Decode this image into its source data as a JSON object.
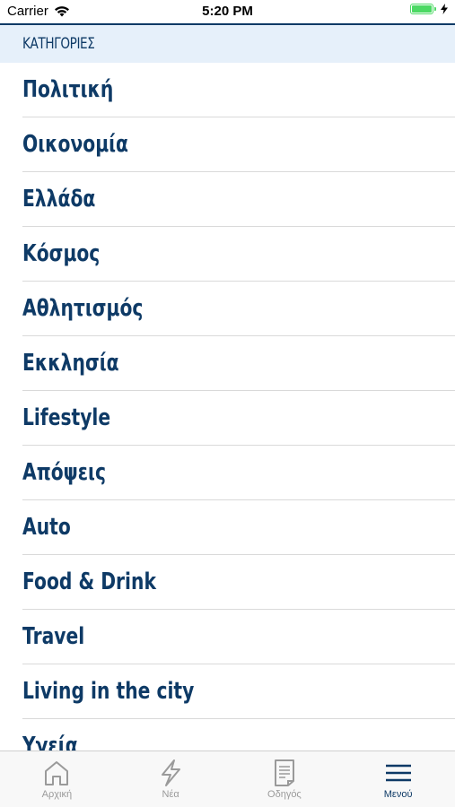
{
  "status_bar": {
    "carrier": "Carrier",
    "time": "5:20 PM",
    "battery_level": 1.0
  },
  "section": {
    "title": "ΚΑΤΗΓΟΡΙΕΣ"
  },
  "categories": [
    "Πολιτική",
    "Οικονομία",
    "Ελλάδα",
    "Κόσμος",
    "Αθλητισμός",
    "Εκκλησία",
    "Lifestyle",
    "Απόψεις",
    "Auto",
    "Food & Drink",
    "Travel",
    "Living in the city",
    "Υγεία"
  ],
  "tabs": [
    {
      "label": "Αρχική",
      "icon": "home-icon",
      "active": false
    },
    {
      "label": "Νέα",
      "icon": "lightning-icon",
      "active": false
    },
    {
      "label": "Οδηγός",
      "icon": "document-icon",
      "active": false
    },
    {
      "label": "Μενού",
      "icon": "menu-icon",
      "active": true
    }
  ],
  "colors": {
    "brand": "#0e3a66",
    "header_bg": "#e6f0fa",
    "inactive": "#9a9a9a",
    "battery": "#4cd964"
  }
}
